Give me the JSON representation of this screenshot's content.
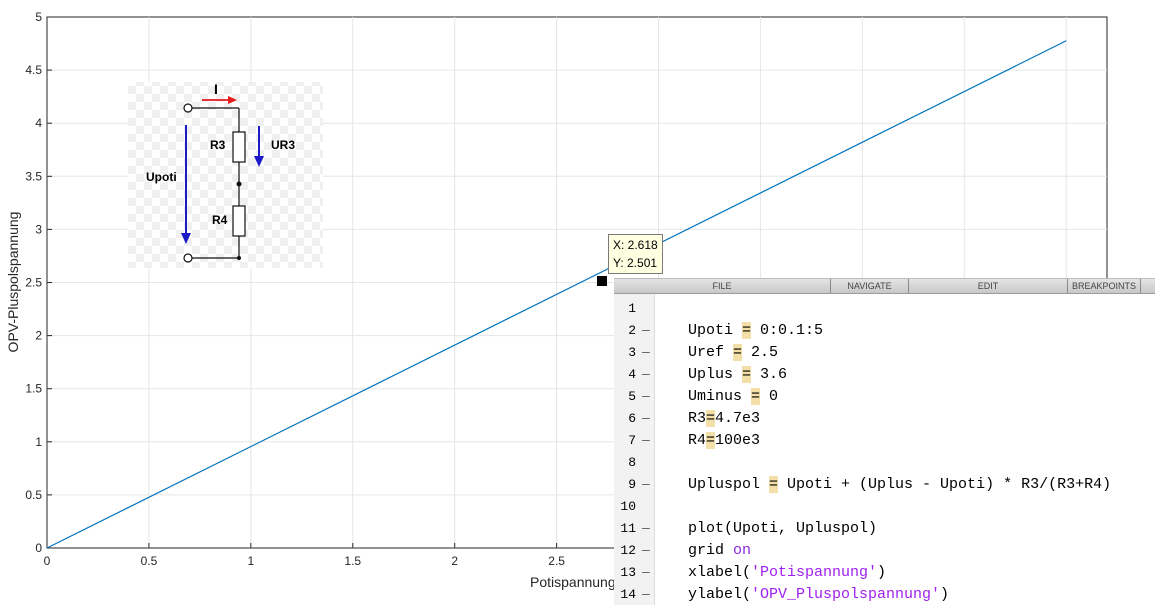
{
  "chart_data": {
    "type": "line",
    "x": [
      0,
      5
    ],
    "y": [
      0,
      4.7762
    ],
    "xlabel": "Potispannung",
    "ylabel": "OPV-Pluspolspannung",
    "xlim": [
      0,
      5.2
    ],
    "ylim": [
      0,
      5
    ],
    "xticks": [
      0,
      0.5,
      1,
      1.5,
      2,
      2.5
    ],
    "xtick_labels": [
      "0",
      "0.5",
      "1",
      "1.5",
      "2",
      "2.5"
    ],
    "yticks": [
      0,
      0.5,
      1,
      1.5,
      2,
      2.5,
      3,
      3.5,
      4,
      4.5,
      5
    ],
    "ytick_labels": [
      "0",
      "0.5",
      "1",
      "1.5",
      "2",
      "2.5",
      "3",
      "3.5",
      "4",
      "4.5",
      "5"
    ],
    "grid": true,
    "line_color": "#0072bd",
    "datatip": {
      "x": 2.618,
      "y": 2.501,
      "x_label": "X: 2.618",
      "y_label": "Y: 2.501"
    }
  },
  "circuit": {
    "current_label": "I",
    "r3_label": "R3",
    "ur3_label": "UR3",
    "upoti_label": "Upoti",
    "r4_label": "R4"
  },
  "editor": {
    "tabs": [
      "FILE",
      "NAVIGATE",
      "EDIT",
      "BREAKPOINTS"
    ],
    "lines": [
      {
        "num": "1",
        "text": ""
      },
      {
        "num": "2",
        "text": "Upoti = 0:0.1:5"
      },
      {
        "num": "3",
        "text": "Uref = 2.5"
      },
      {
        "num": "4",
        "text": "Uplus = 3.6"
      },
      {
        "num": "5",
        "text": "Uminus = 0"
      },
      {
        "num": "6",
        "text": "R3=4.7e3"
      },
      {
        "num": "7",
        "text": "R4=100e3"
      },
      {
        "num": "8",
        "text": ""
      },
      {
        "num": "9",
        "text": "Upluspol = Upoti + (Uplus - Upoti) * R3/(R3+R4)"
      },
      {
        "num": "10",
        "text": ""
      },
      {
        "num": "11",
        "text": "plot(Upoti, Upluspol)"
      },
      {
        "num": "12",
        "text": "grid on"
      },
      {
        "num": "13",
        "text": "xlabel('Potispannung')"
      },
      {
        "num": "14",
        "text": "ylabel('OPV_Pluspolspannung')"
      }
    ]
  }
}
